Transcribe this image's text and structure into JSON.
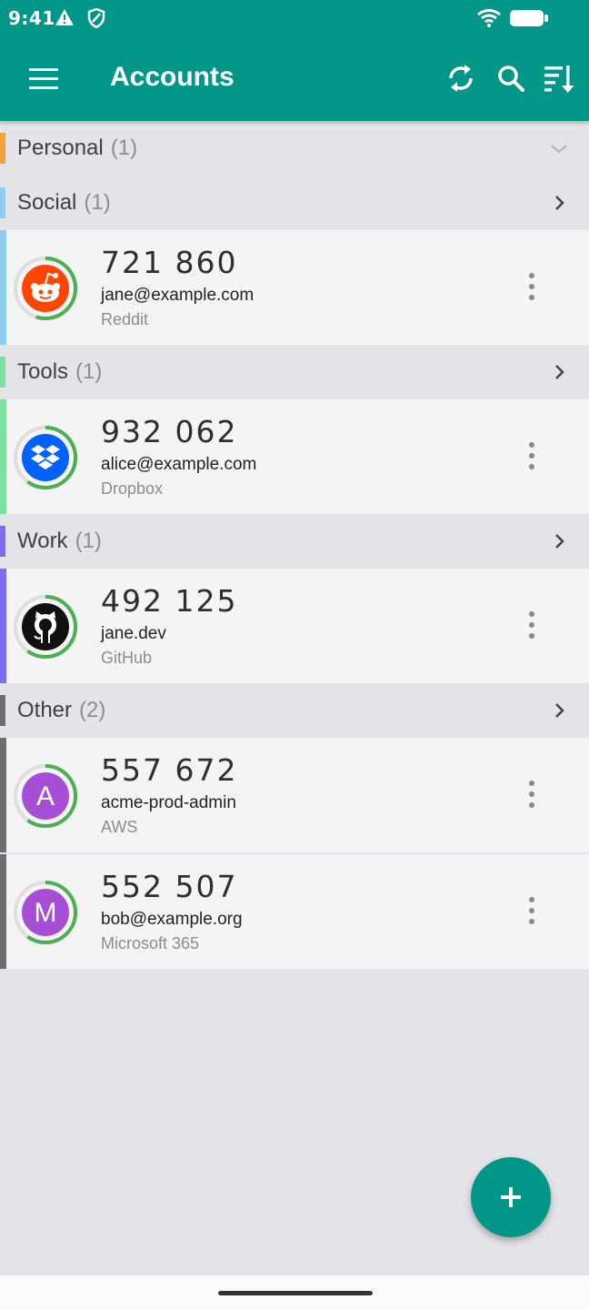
{
  "status_bar": {
    "time": "9:41",
    "icons": [
      "warning-icon",
      "shield-icon",
      "wifi-icon",
      "battery-icon"
    ]
  },
  "app_bar": {
    "title": "Accounts",
    "actions": [
      "menu-icon",
      "sync-icon",
      "search-icon",
      "sort-icon"
    ]
  },
  "groups": [
    {
      "name": "Personal",
      "count": "(1)",
      "color": "#f4a23a",
      "expanded": true,
      "entries": []
    },
    {
      "name": "Social",
      "count": "(1)",
      "color": "#8fcdf2",
      "entries": [
        {
          "code": "721 860",
          "account": "jane@example.com",
          "issuer": "Reddit",
          "icon": "reddit-icon",
          "icon_color": "#ff4500",
          "progress": 0.55
        }
      ]
    },
    {
      "name": "Tools",
      "count": "(1)",
      "color": "#7be0a0",
      "entries": [
        {
          "code": "932 062",
          "account": "alice@example.com",
          "issuer": "Dropbox",
          "icon": "dropbox-icon",
          "icon_color": "#0061ff",
          "progress": 0.6
        }
      ]
    },
    {
      "name": "Work",
      "count": "(1)",
      "color": "#7b6cf0",
      "entries": [
        {
          "code": "492 125",
          "account": "jane.dev",
          "issuer": "GitHub",
          "icon": "github-icon",
          "icon_color": "#111111",
          "progress": 0.6
        }
      ]
    },
    {
      "name": "Other",
      "count": "(2)",
      "color": "#6e6e6e",
      "entries": [
        {
          "code": "557 672",
          "account": "acme-prod-admin",
          "issuer": "AWS",
          "icon": "letter-a-icon",
          "letter": "A",
          "icon_color": "#a64fd6",
          "progress": 0.6
        },
        {
          "code": "552 507",
          "account": "bob@example.org",
          "issuer": "Microsoft 365",
          "icon": "letter-m-icon",
          "letter": "M",
          "icon_color": "#a64fd6",
          "progress": 0.6
        }
      ]
    }
  ],
  "fab": {
    "icon": "plus-icon"
  },
  "colors": {
    "primary": "#009688",
    "progress": "#4caf50"
  }
}
